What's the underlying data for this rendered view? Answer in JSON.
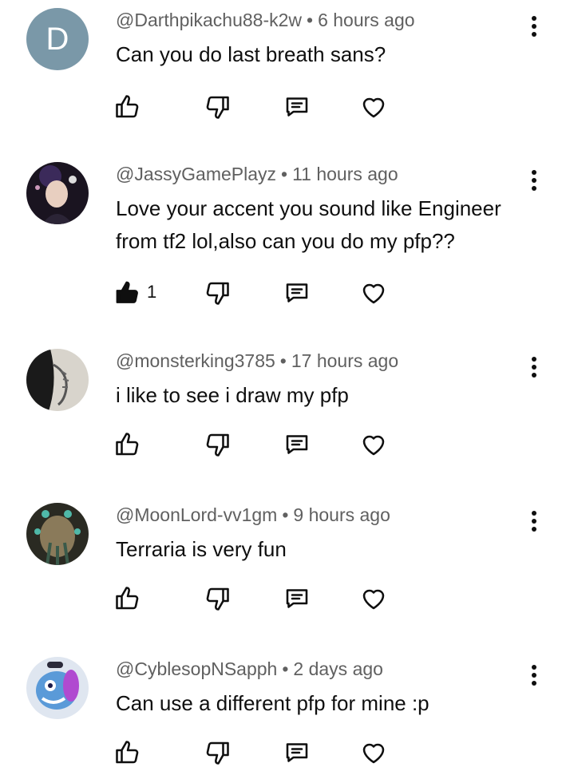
{
  "comments": [
    {
      "handle": "@Darthpikachu88-k2w",
      "time": "6 hours ago",
      "text": "Can you do last breath sans?",
      "avatar": "letter",
      "avatar_letter": "D",
      "likes": "",
      "liked": false
    },
    {
      "handle": "@JassyGamePlayz",
      "time": "11 hours ago",
      "text": "Love your accent you sound like Engineer from tf2 lol,also can you do my pfp??",
      "avatar": "image",
      "avatar_letter": "",
      "likes": "1",
      "liked": true
    },
    {
      "handle": "@monsterking3785",
      "time": "17 hours ago",
      "text": "i like to see i draw my pfp",
      "avatar": "image",
      "avatar_letter": "",
      "likes": "",
      "liked": false
    },
    {
      "handle": "@MoonLord-vv1gm",
      "time": "9 hours ago",
      "text": "Terraria is very fun",
      "avatar": "image",
      "avatar_letter": "",
      "likes": "",
      "liked": false
    },
    {
      "handle": "@CyblesopNSapph",
      "time": "2 days ago",
      "text": "Can use a different pfp for mine :p",
      "avatar": "image",
      "avatar_letter": "",
      "likes": "",
      "liked": false
    }
  ],
  "separator": "•",
  "icons": {
    "like": "thumbs-up-icon",
    "dislike": "thumbs-down-icon",
    "reply": "reply-comment-icon",
    "heart": "heart-icon",
    "menu": "more-vert-icon"
  },
  "colors": {
    "meta": "#606060",
    "text": "#0f0f0f",
    "avatar_letter_bg": "#7a98a8"
  }
}
